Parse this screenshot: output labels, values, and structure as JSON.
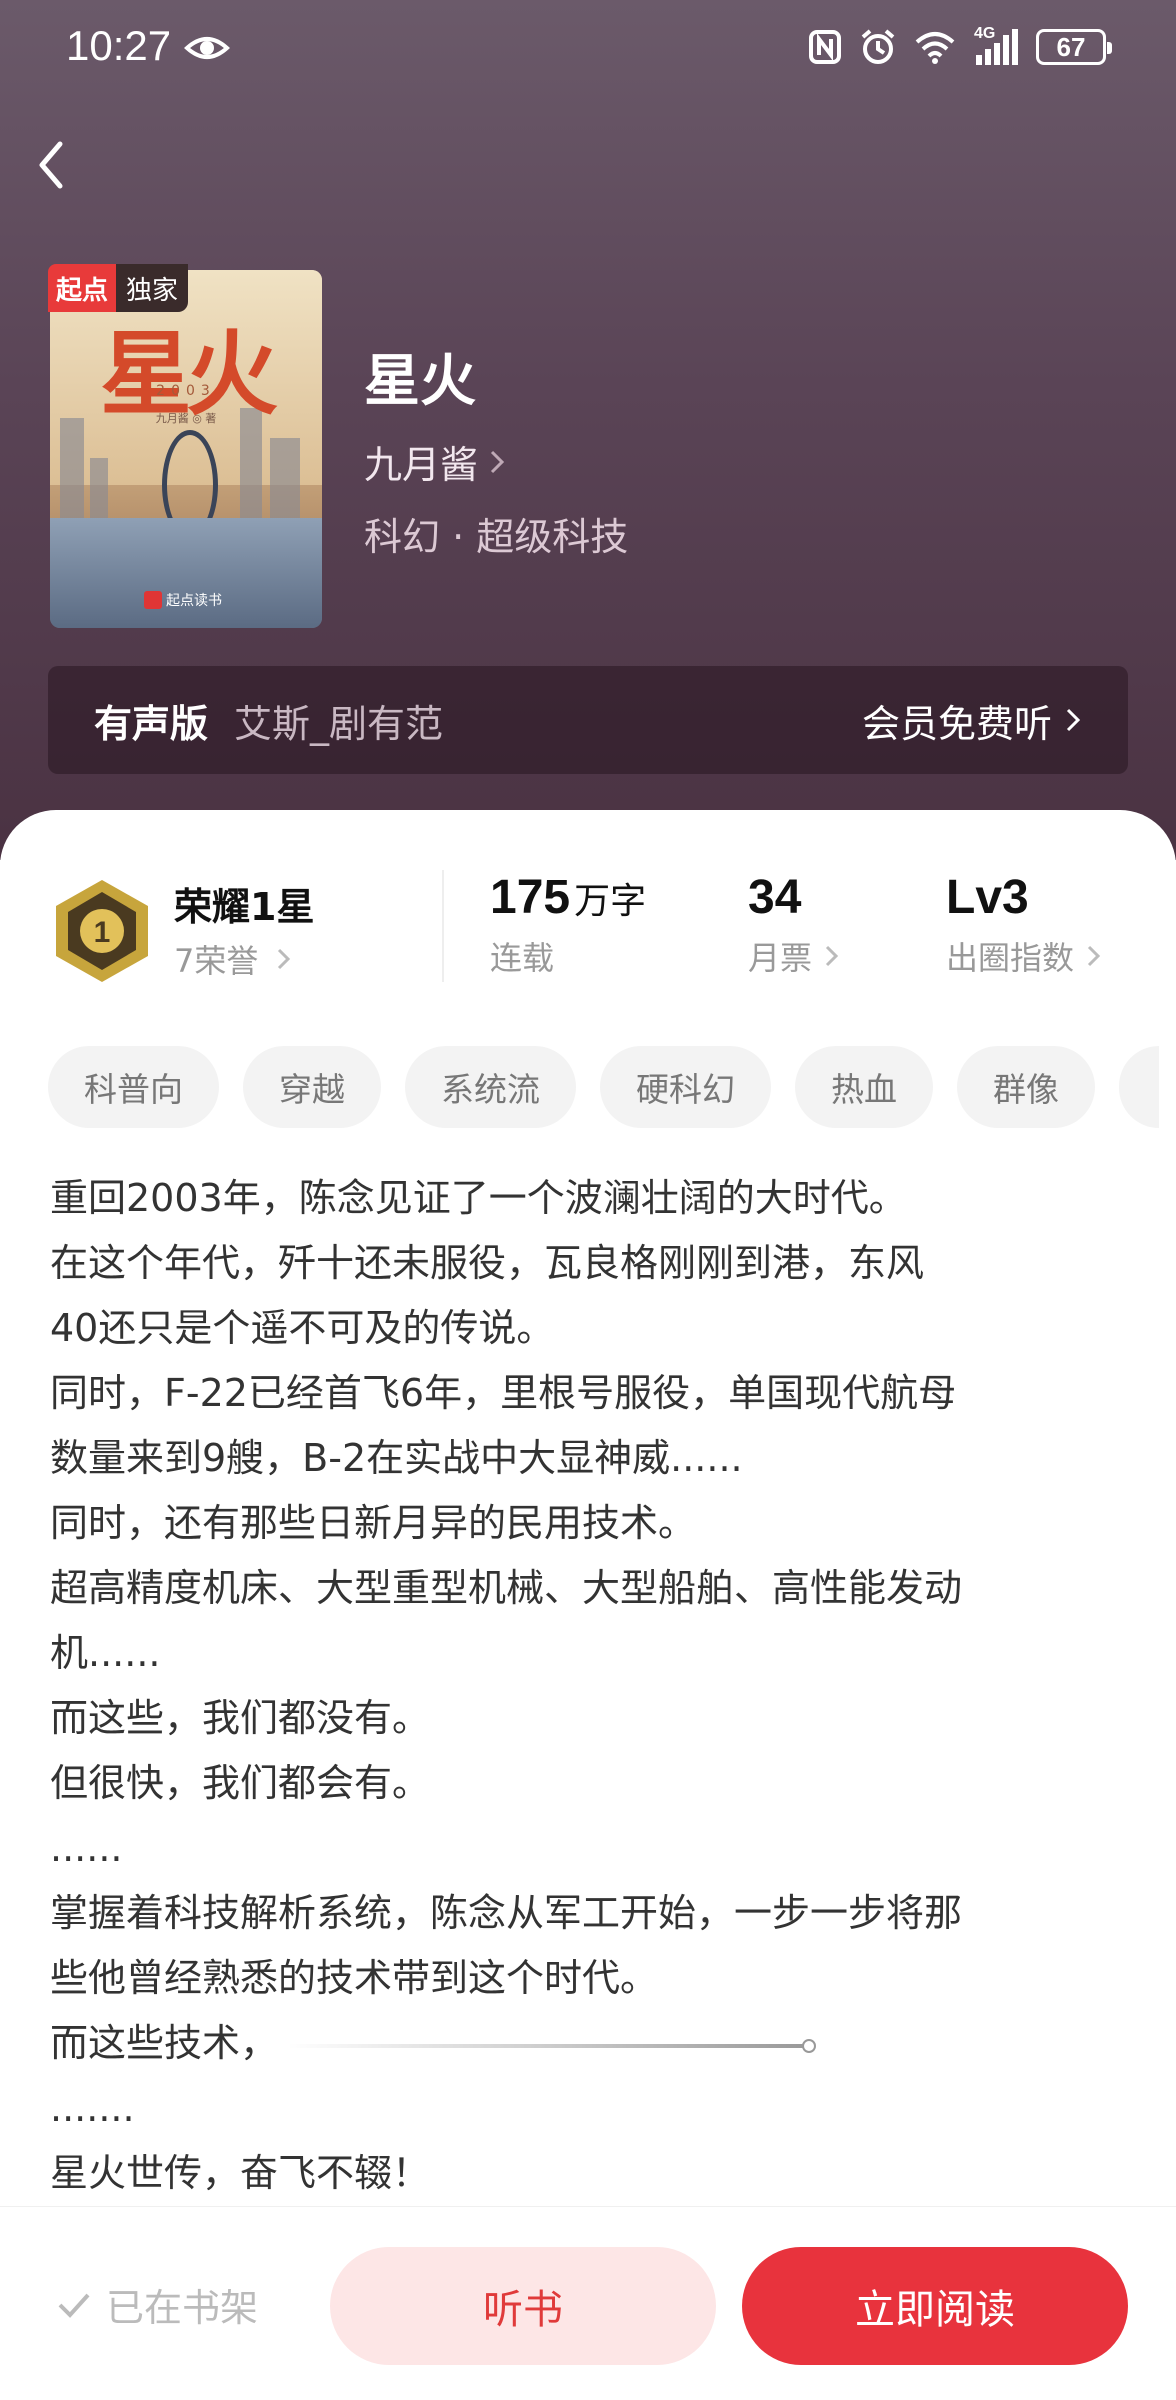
{
  "status_bar": {
    "time": "10:27",
    "battery": "67",
    "network": "4G"
  },
  "book": {
    "badge_brand": "起点",
    "badge_exclusive": "独家",
    "cover_title": "星火",
    "cover_year": "2003",
    "cover_author": "九月酱 ◎ 著",
    "cover_publisher": "起点读书",
    "title": "星火",
    "author": "九月酱",
    "genre": "科幻 · 超级科技"
  },
  "audio": {
    "label": "有声版",
    "narrator": "艾斯_剧有范",
    "cta": "会员免费听"
  },
  "stats": {
    "honor_title": "荣耀1星",
    "honor_sub": "7荣誉",
    "words_value": "175",
    "words_unit": "万字",
    "words_label": "连载",
    "tickets_value": "34",
    "tickets_label": "月票",
    "level_value": "Lv3",
    "level_label": "出圈指数"
  },
  "tags": [
    "科普向",
    "穿越",
    "系统流",
    "硬科幻",
    "热血",
    "群像"
  ],
  "intro": [
    "重回2003年，陈念见证了一个波澜壮阔的大时代。",
    "在这个年代，歼十还未服役，瓦良格刚刚到港，东风",
    "40还只是个遥不可及的传说。",
    "同时，F-22已经首飞6年，里根号服役，单国现代航母",
    "数量来到9艘，B-2在实战中大显神威......",
    "同时，还有那些日新月异的民用技术。",
    "超高精度机床、大型重型机械、大型船舶、高性能发动",
    "机......",
    "而这些，我们都没有。",
    "但很快，我们都会有。",
    "......",
    "掌握着科技解析系统，陈念从军工开始，一步一步将那",
    "些他曾经熟悉的技术带到这个时代。",
    "而这些技术，",
    ".......",
    "星火世传，奋飞不辍！"
  ],
  "bottom": {
    "shelf": "已在书架",
    "listen": "听书",
    "read": "立即阅读"
  },
  "colors": {
    "accent": "#e8333d",
    "hero": "#5a4456"
  }
}
